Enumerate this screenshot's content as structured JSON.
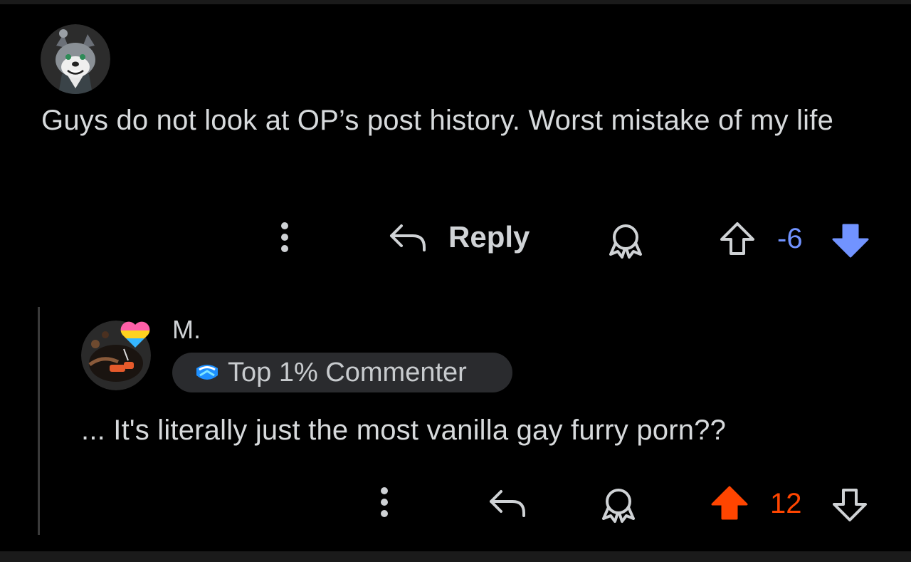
{
  "comments": [
    {
      "text": "Guys do not look at OP’s post history. Worst mistake of my life",
      "actions": {
        "reply_label": "Reply",
        "score": "-6"
      },
      "vote_state": "downvoted",
      "vote_color": "#7193ff"
    },
    {
      "username": "M.",
      "flair": "Top 1% Commenter",
      "text": "... It's literally just the most vanilla gay furry porn??",
      "actions": {
        "score": "12"
      },
      "vote_state": "upvoted",
      "vote_color": "#ff4500"
    }
  ],
  "icons": {
    "more": "more-vertical-icon",
    "reply": "reply-arrow-icon",
    "award": "award-icon",
    "upvote": "upvote-arrow-icon",
    "downvote": "downvote-arrow-icon",
    "flair_badge": "commenter-badge-icon",
    "pride_heart": "pride-heart-icon"
  },
  "colors": {
    "background": "#000000",
    "text": "#d7dadc",
    "icon": "#cfd2d5",
    "flair_bg": "#2a2b2e"
  }
}
